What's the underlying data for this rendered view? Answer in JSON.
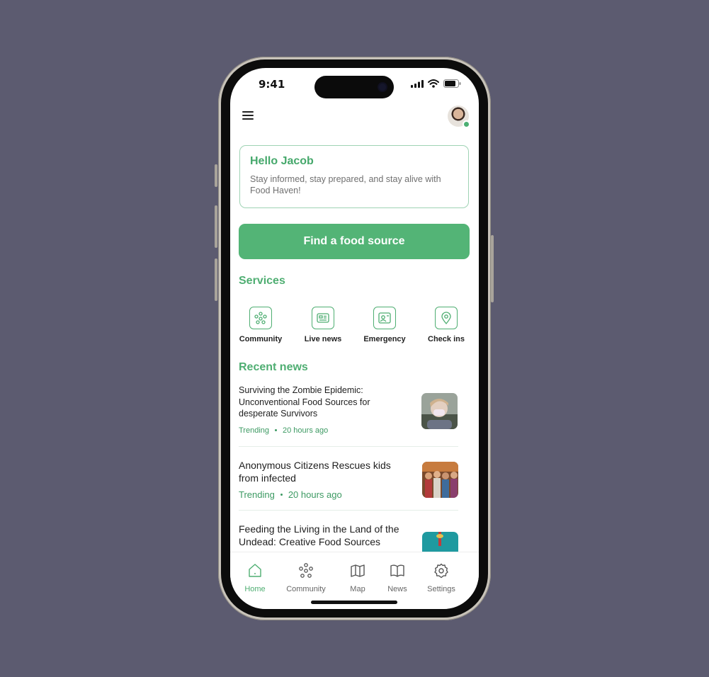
{
  "status_bar": {
    "time": "9:41"
  },
  "greeting": {
    "title": "Hello Jacob",
    "text": "Stay informed, stay prepared, and stay alive with Food Haven!"
  },
  "cta": {
    "label": "Find a food source"
  },
  "services": {
    "title": "Services",
    "items": [
      {
        "label": "Community",
        "icon": "community-icon"
      },
      {
        "label": "Live news",
        "icon": "newspaper-icon"
      },
      {
        "label": "Emergency",
        "icon": "id-card-icon"
      },
      {
        "label": "Check ins",
        "icon": "location-pin-icon"
      }
    ]
  },
  "recent_news": {
    "title": "Recent news",
    "items": [
      {
        "title": "Surviving the Zombie Epidemic: Unconventional Food Sources for desperate Survivors",
        "tag": "Trending",
        "time": "20 hours ago"
      },
      {
        "title": "Anonymous Citizens Rescues kids from infected",
        "tag": "Trending",
        "time": "20 hours ago"
      },
      {
        "title": "Feeding the Living in the Land of the Undead: Creative Food Sources"
      }
    ]
  },
  "bottom_nav": {
    "items": [
      {
        "label": "Home",
        "icon": "home-icon",
        "active": true
      },
      {
        "label": "Community",
        "icon": "community-icon"
      },
      {
        "label": "Map",
        "icon": "map-icon"
      },
      {
        "label": "News",
        "icon": "book-icon"
      },
      {
        "label": "Settings",
        "icon": "gear-icon"
      }
    ]
  },
  "colors": {
    "accent": "#53b476",
    "accent_text": "#4fae72",
    "background": "#5c5b70"
  }
}
